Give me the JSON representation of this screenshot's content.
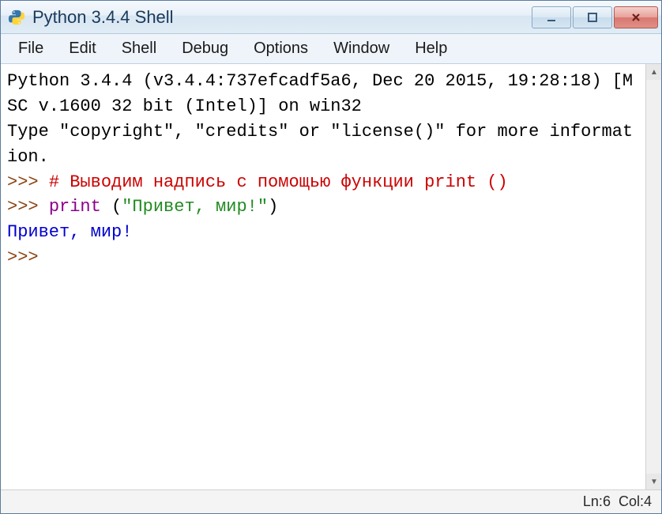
{
  "window": {
    "title": "Python 3.4.4 Shell"
  },
  "menubar": {
    "items": [
      "File",
      "Edit",
      "Shell",
      "Debug",
      "Options",
      "Window",
      "Help"
    ]
  },
  "console": {
    "banner_line1": "Python 3.4.4 (v3.4.4:737efcadf5a6, Dec 20 2015, 19:28:18) [MSC v.1600 32 bit (Intel)] on win32",
    "banner_line2": "Type \"copyright\", \"credits\" or \"license()\" for more information.",
    "prompt": ">>> ",
    "comment_line": "# Выводим надпись с помощью функции print ()",
    "print_keyword": "print",
    "print_rest_open": " (",
    "print_string": "\"Привет, мир!\"",
    "print_rest_close": ")",
    "output_line": "Привет, мир!"
  },
  "statusbar": {
    "ln_label": "Ln: ",
    "ln_value": "6",
    "col_label": "Col: ",
    "col_value": "4"
  }
}
